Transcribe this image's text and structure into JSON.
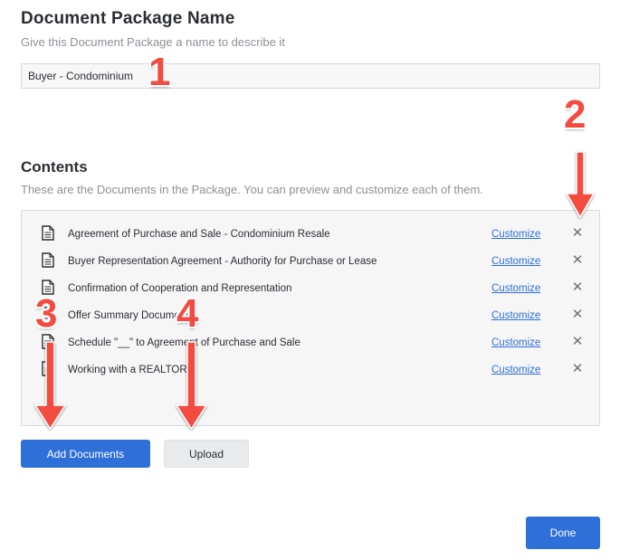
{
  "header": {
    "title": "Document Package Name",
    "subtitle": "Give this Document Package a name to describe it"
  },
  "package_name": {
    "value": "Buyer - Condominium"
  },
  "contents": {
    "title": "Contents",
    "subtitle": "These are the Documents in the Package. You can preview and customize each of them.",
    "customize_label": "Customize",
    "documents": [
      {
        "title": "Agreement of Purchase and Sale - Condominium Resale"
      },
      {
        "title": "Buyer Representation Agreement - Authority for Purchase or Lease"
      },
      {
        "title": "Confirmation of Cooperation and Representation"
      },
      {
        "title": "Offer Summary Document"
      },
      {
        "title": "Schedule \"__\" to Agreement of Purchase and Sale"
      },
      {
        "title": "Working with a REALTOR"
      }
    ]
  },
  "actions": {
    "add_documents_label": "Add Documents",
    "upload_label": "Upload",
    "done_label": "Done"
  },
  "annotations": [
    "1",
    "2",
    "3",
    "4"
  ],
  "colors": {
    "primary": "#2f6fd8",
    "link": "#2e6fd6",
    "annotation": "#f24b41"
  }
}
